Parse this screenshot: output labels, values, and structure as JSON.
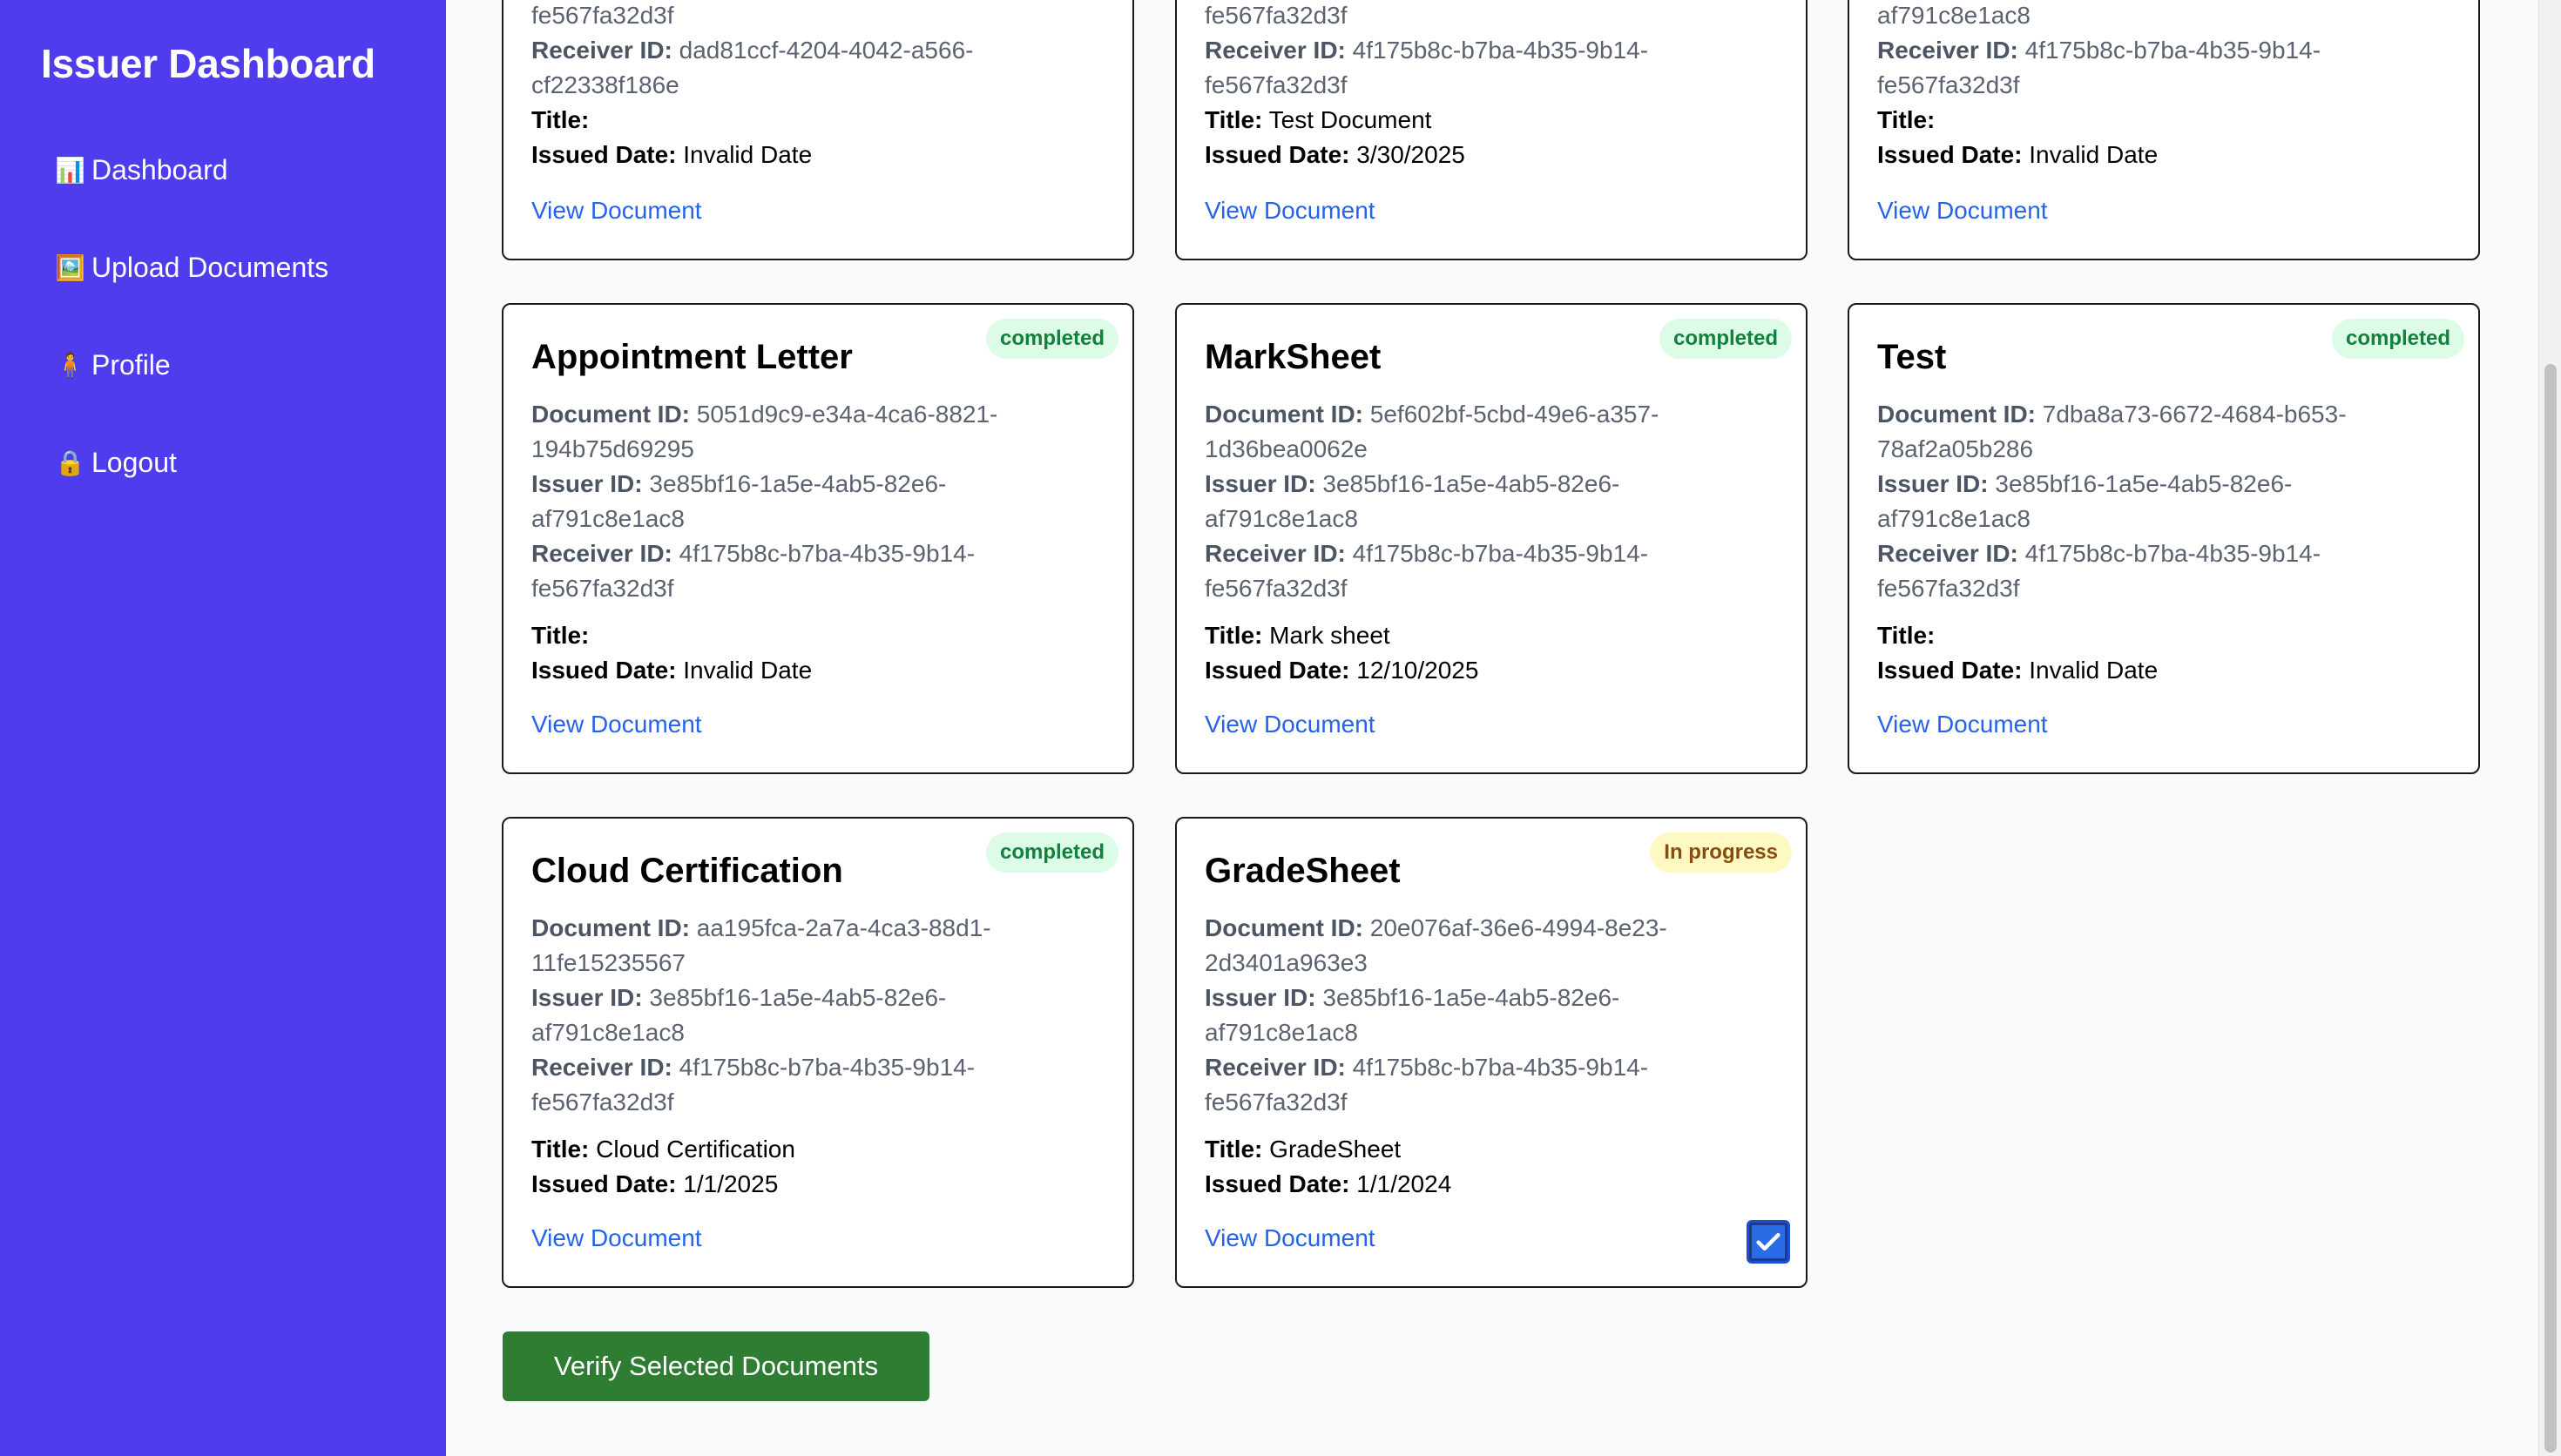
{
  "sidebar": {
    "title": "Issuer Dashboard",
    "items": [
      {
        "icon": "📊",
        "label": "Dashboard"
      },
      {
        "icon": "🖼️",
        "label": "Upload Documents"
      },
      {
        "icon": "🧍",
        "label": "Profile"
      },
      {
        "icon": "🔒",
        "label": "Logout"
      }
    ]
  },
  "labels": {
    "document_id": "Document ID:",
    "issuer_id": "Issuer ID:",
    "receiver_id": "Receiver ID:",
    "title": "Title:",
    "issued_date": "Issued Date:",
    "view": "View Document"
  },
  "top_cards": [
    {
      "partial_line": "fe567fa32d3f",
      "receiver_id": "dad81ccf-4204-4042-a566-cf22338f186e",
      "title": "",
      "issued_date": "Invalid Date"
    },
    {
      "partial_line": "fe567fa32d3f",
      "receiver_id": "4f175b8c-b7ba-4b35-9b14-fe567fa32d3f",
      "title": "Test Document",
      "issued_date": "3/30/2025"
    },
    {
      "partial_line": "af791c8e1ac8",
      "receiver_id": "4f175b8c-b7ba-4b35-9b14-fe567fa32d3f",
      "title": "",
      "issued_date": "Invalid Date"
    }
  ],
  "cards": [
    {
      "name": "Appointment Letter",
      "status": "completed",
      "document_id": "5051d9c9-e34a-4ca6-8821-194b75d69295",
      "issuer_id": "3e85bf16-1a5e-4ab5-82e6-af791c8e1ac8",
      "receiver_id": "4f175b8c-b7ba-4b35-9b14-fe567fa32d3f",
      "title": "",
      "issued_date": "Invalid Date"
    },
    {
      "name": "MarkSheet",
      "status": "completed",
      "document_id": "5ef602bf-5cbd-49e6-a357-1d36bea0062e",
      "issuer_id": "3e85bf16-1a5e-4ab5-82e6-af791c8e1ac8",
      "receiver_id": "4f175b8c-b7ba-4b35-9b14-fe567fa32d3f",
      "title": "Mark sheet",
      "issued_date": "12/10/2025"
    },
    {
      "name": "Test",
      "status": "completed",
      "document_id": "7dba8a73-6672-4684-b653-78af2a05b286",
      "issuer_id": "3e85bf16-1a5e-4ab5-82e6-af791c8e1ac8",
      "receiver_id": "4f175b8c-b7ba-4b35-9b14-fe567fa32d3f",
      "title": "",
      "issued_date": "Invalid Date"
    },
    {
      "name": "Cloud Certification",
      "status": "completed",
      "document_id": "aa195fca-2a7a-4ca3-88d1-11fe15235567",
      "issuer_id": "3e85bf16-1a5e-4ab5-82e6-af791c8e1ac8",
      "receiver_id": "4f175b8c-b7ba-4b35-9b14-fe567fa32d3f",
      "title": "Cloud Certification",
      "issued_date": "1/1/2025"
    },
    {
      "name": "GradeSheet",
      "status": "In progress",
      "document_id": "20e076af-36e6-4994-8e23-2d3401a963e3",
      "issuer_id": "3e85bf16-1a5e-4ab5-82e6-af791c8e1ac8",
      "receiver_id": "4f175b8c-b7ba-4b35-9b14-fe567fa32d3f",
      "title": "GradeSheet",
      "issued_date": "1/1/2024",
      "selected": true
    }
  ],
  "verify_button": "Verify Selected Documents",
  "colors": {
    "sidebar": "#4f3ced",
    "verify": "#2e7d32",
    "link": "#2563eb"
  }
}
